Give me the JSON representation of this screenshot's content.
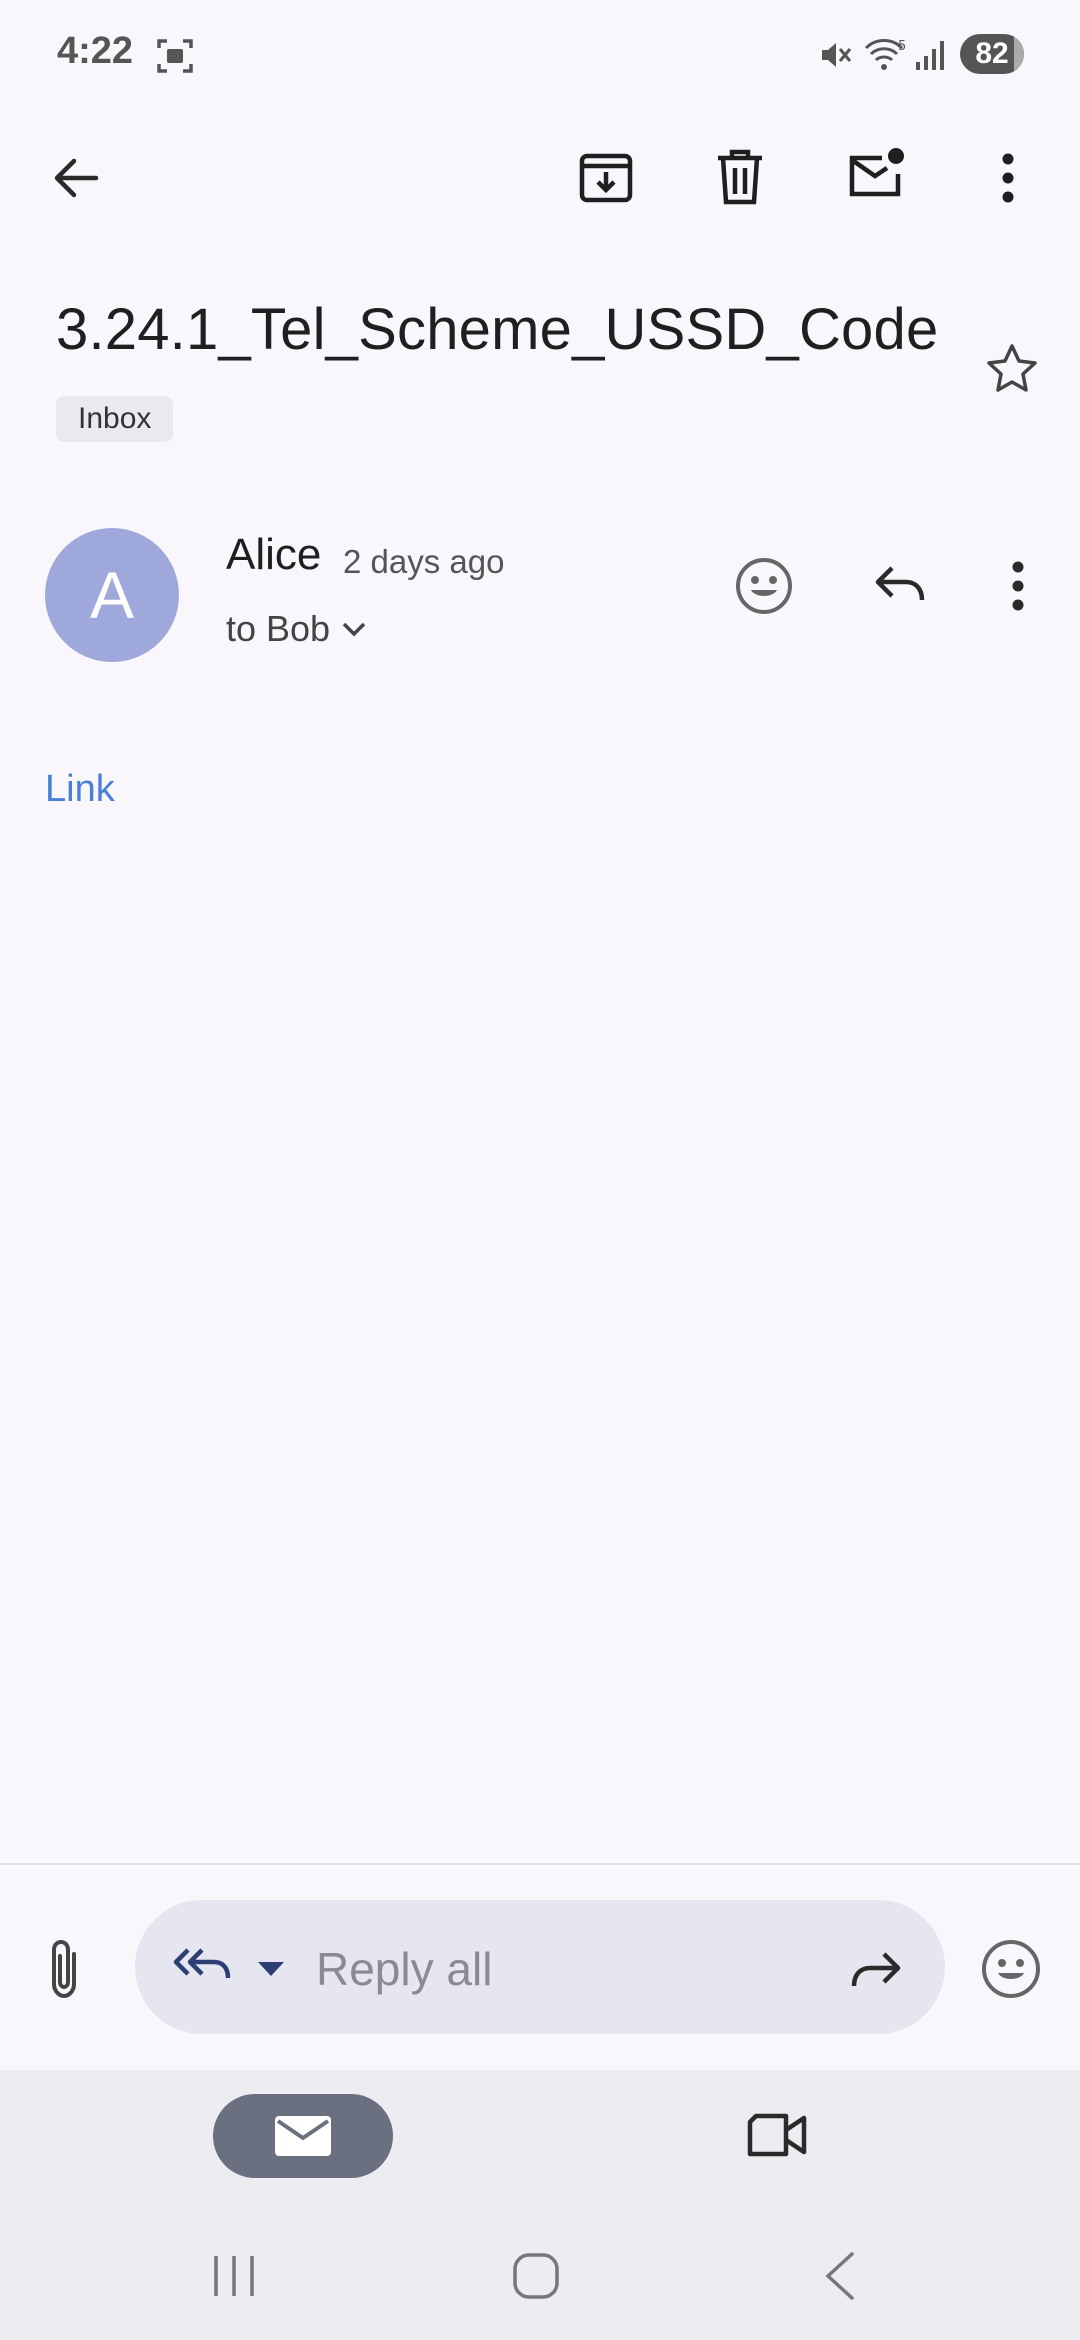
{
  "status_bar": {
    "time": "4:22",
    "battery": "82",
    "icons": [
      "screenshot-icon",
      "mute-icon",
      "wifi-icon",
      "signal-icon"
    ]
  },
  "toolbar": {
    "icons": [
      "back-arrow-icon",
      "archive-icon",
      "delete-icon",
      "mark-unread-icon",
      "more-vert-icon"
    ]
  },
  "email": {
    "subject": "3.24.1_Tel_Scheme_USSD_Code",
    "label": "Inbox",
    "sender_initial": "A",
    "sender": "Alice",
    "time_ago": "2 days ago",
    "recipient_line": "to Bob",
    "body_link": "Link"
  },
  "reply_bar": {
    "placeholder": "Reply all"
  },
  "colors": {
    "background": "#f9f6fc",
    "avatar": "#9fa8da",
    "link": "#4a7fd9",
    "reply_pill": "#e6e6f0",
    "nav_active": "#6b7081"
  }
}
